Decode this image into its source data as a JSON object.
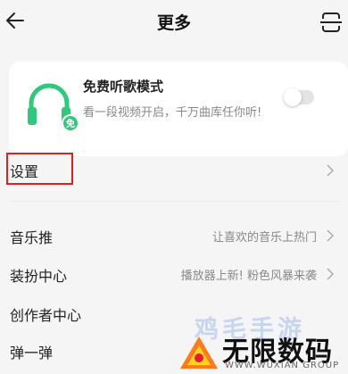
{
  "header": {
    "title": "更多",
    "back_icon": "arrow-left-icon",
    "scan_icon": "scan-icon"
  },
  "listening_mode": {
    "title": "免费听歌模式",
    "description": "看一段视频开启，千万曲库任你听!",
    "icon": "headphones-free-icon",
    "badge": "免",
    "accent_color": "#2ec97a",
    "toggle_on": false
  },
  "settings": {
    "label": "设置",
    "highlight_color": "#e02020"
  },
  "menu": {
    "items": [
      {
        "label": "音乐推",
        "value": "让喜欢的音乐上热门"
      },
      {
        "label": "装扮中心",
        "value": "播放器上新! 粉色风暴来袭"
      },
      {
        "label": "创作者中心",
        "value": ""
      },
      {
        "label": "弹一弹",
        "value": ""
      }
    ]
  },
  "watermark": {
    "faint_text": "鸡毛手游",
    "main_text": "无限数码",
    "sub_text": "WWW.WUXIAN GROUP"
  }
}
